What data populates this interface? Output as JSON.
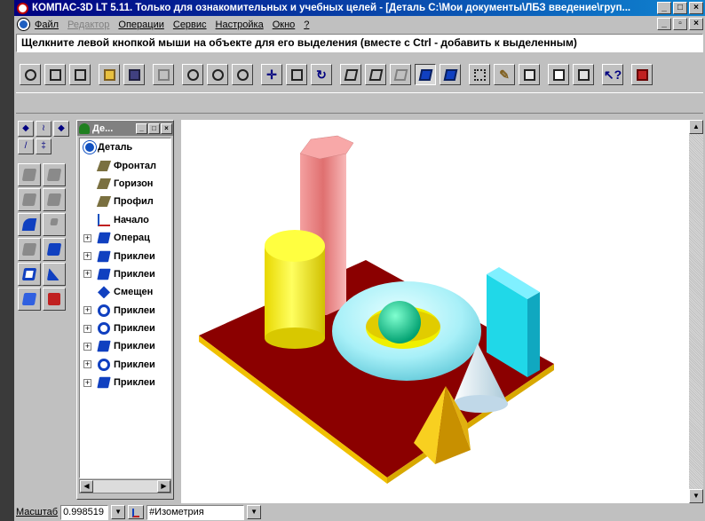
{
  "window": {
    "title": "КОМПАС-3D LT 5.11. Только для ознакомительных и учебных целей - [Деталь С:\\Мои документы\\ЛБЗ введение\\груп...",
    "buttons": [
      "_",
      "□",
      "×"
    ]
  },
  "menu": {
    "items": [
      {
        "label": "Файл",
        "enabled": true
      },
      {
        "label": "Редактор",
        "enabled": false
      },
      {
        "label": "Операции",
        "enabled": true
      },
      {
        "label": "Сервис",
        "enabled": true
      },
      {
        "label": "Настройка",
        "enabled": true
      },
      {
        "label": "Окно",
        "enabled": true
      },
      {
        "label": "?",
        "enabled": true
      }
    ],
    "mdi_buttons": [
      "_",
      "▫",
      "×"
    ]
  },
  "hint": "Щелкните левой кнопкой мыши на объекте для его выделения (вместе с Ctrl - добавить к выделенным)",
  "toolbar": {
    "buttons": [
      "properties-icon",
      "new-file-icon",
      "new-document-icon",
      "open-folder-icon",
      "save-disk-icon",
      "rebuild-icon",
      "zoom-window-icon",
      "zoom-in-icon",
      "zoom-out-icon",
      "pan-icon",
      "fit-icon",
      "rotate-icon",
      "wireframe-icon",
      "hidden-lines-icon",
      "hidden-thin-icon",
      "shaded-icon",
      "shaded-edges-icon",
      "model-tree-icon",
      "measure-icon",
      "calculator-icon",
      "preview-icon",
      "print-icon",
      "help-icon",
      "exit-icon"
    ]
  },
  "tree": {
    "title": "Де...",
    "root": "Деталь",
    "items": [
      {
        "label": "Фронтал",
        "icon": "plane",
        "expandable": false
      },
      {
        "label": "Горизон",
        "icon": "plane",
        "expandable": false
      },
      {
        "label": "Профил",
        "icon": "plane",
        "expandable": false
      },
      {
        "label": "Начало",
        "icon": "origin",
        "expandable": false
      },
      {
        "label": "Операц",
        "icon": "solid",
        "expandable": true
      },
      {
        "label": "Приклеи",
        "icon": "solid",
        "expandable": true
      },
      {
        "label": "Приклеи",
        "icon": "solid",
        "expandable": true
      },
      {
        "label": "Смещен",
        "icon": "offset",
        "expandable": false
      },
      {
        "label": "Приклеи",
        "icon": "rev",
        "expandable": true
      },
      {
        "label": "Приклеи",
        "icon": "rev",
        "expandable": true
      },
      {
        "label": "Приклеи",
        "icon": "solid",
        "expandable": true
      },
      {
        "label": "Приклеи",
        "icon": "rev",
        "expandable": true
      },
      {
        "label": "Приклеи",
        "icon": "solid",
        "expandable": true
      }
    ]
  },
  "model_colors": {
    "base_plate": "#8b0000",
    "plate_edge": "#f0c000",
    "prism_pink": "#f08080",
    "cylinder_yellow": "#f0f000",
    "torus_cyan": "#a0f0f8",
    "sphere_green": "#20e0a0",
    "box_cyan": "#20e0f0",
    "cone_white": "#e8f8ff",
    "pyramid_gold": "#f0c020"
  },
  "status": {
    "scale_label": "Масштаб",
    "scale_value": "0.998519",
    "orientation": "#Изометрия"
  }
}
